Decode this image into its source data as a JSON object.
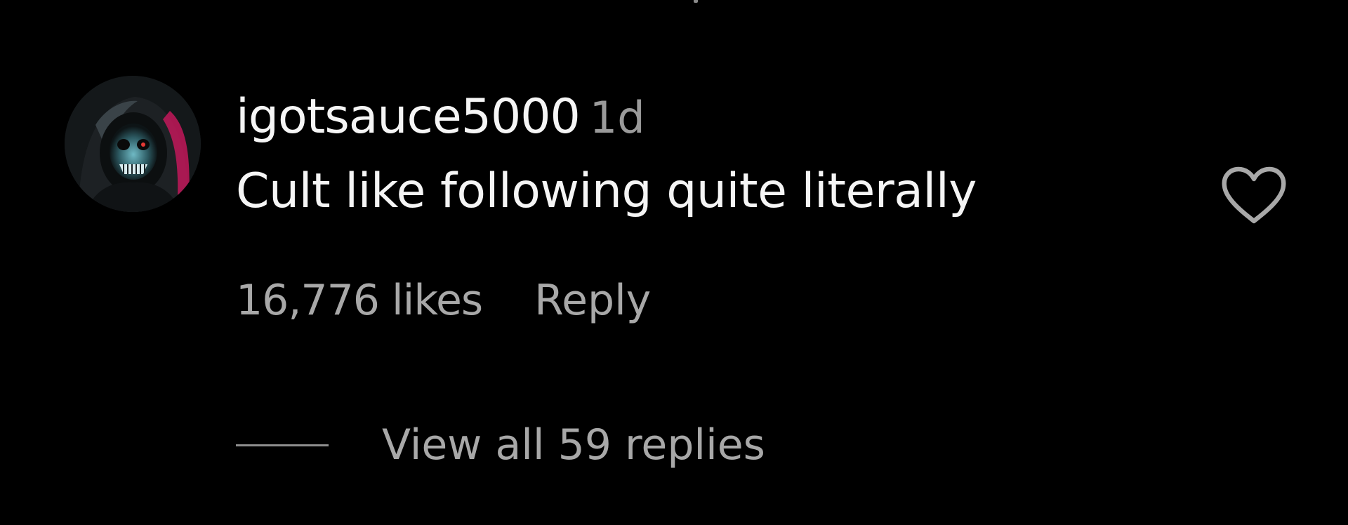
{
  "comment": {
    "avatar_icon": "hooded-skull-avatar",
    "username": "igotsauce5000",
    "timestamp": "1d",
    "text": "Cult like following quite literally",
    "likes": "16,776 likes",
    "reply_label": "Reply",
    "like_icon": "heart-outline-icon",
    "view_replies": "View all 59 replies"
  },
  "colors": {
    "background": "#000000",
    "primary_text": "#f5f5f5",
    "secondary_text": "#a8a8a8",
    "avatar_accent": "#c2185b"
  }
}
